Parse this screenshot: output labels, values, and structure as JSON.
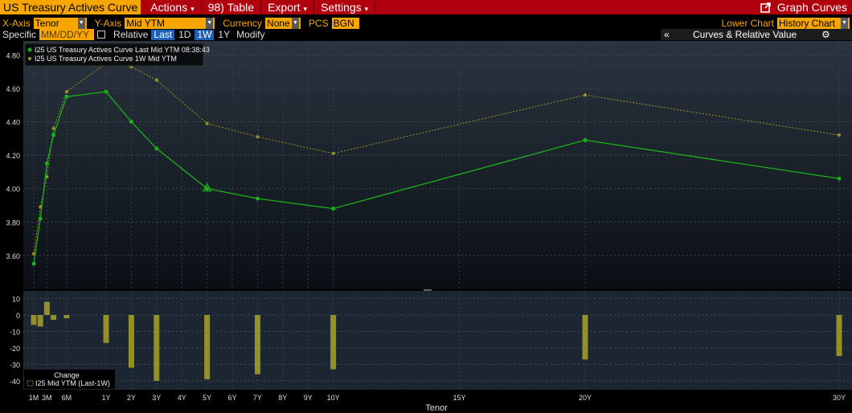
{
  "toolbar": {
    "title": "US Treasury Actives Curve",
    "actions_label": "Actions",
    "table_label": "98) Table",
    "export_label": "Export",
    "settings_label": "Settings",
    "graph_curves_label": "Graph Curves"
  },
  "controls": {
    "xaxis_label": "X-Axis",
    "xaxis_value": "Tenor",
    "yaxis_label": "Y-Axis",
    "yaxis_value": "Mid YTM",
    "currency_label": "Currency",
    "currency_value": "None",
    "pcs_label": "PCS",
    "pcs_value": "BGN",
    "lower_chart_label": "Lower Chart",
    "lower_chart_value": "History Chart",
    "specific_label": "Specific",
    "date_placeholder": "MM/DD/YY",
    "relative_label": "Relative",
    "relative_options": [
      "Last",
      "1D",
      "1W",
      "1Y"
    ],
    "relative_active": [
      "Last",
      "1W"
    ],
    "modify_label": "Modify",
    "panel_collapse": "«",
    "panel_title": "Curves & Relative Value",
    "panel_gear": "⚙"
  },
  "colors": {
    "menubar": "#b0000e",
    "accent": "#f7a600",
    "last_curve": "#19b119",
    "week_curve": "#9f9320",
    "bars": "#a8a326",
    "active_button": "#1f61b5"
  },
  "chart_data": {
    "type": "line",
    "legend": {
      "placement": "top-left",
      "entries": [
        "I25 US Treasury Actives Curve Last Mid YTM 08:38:43",
        "I25 US Treasury Actives Curve 1W Mid YTM"
      ]
    },
    "x_labels": [
      "1M",
      "3M",
      "6M",
      "1Y",
      "2Y",
      "3Y",
      "4Y",
      "5Y",
      "6Y",
      "7Y",
      "8Y",
      "9Y",
      "10Y",
      "15Y",
      "20Y",
      "30Y"
    ],
    "xlabel": "Tenor",
    "top": {
      "ylim": [
        3.45,
        4.85
      ],
      "yticks": [
        "3.60",
        "3.80",
        "4.00",
        "4.20",
        "4.40",
        "4.60",
        "4.80"
      ],
      "series": [
        {
          "name": "I25 US Treasury Actives Curve Last Mid YTM 08:38:43",
          "points": [
            [
              "1M",
              3.55
            ],
            [
              "2M",
              3.82
            ],
            [
              "3M",
              4.15
            ],
            [
              "4M",
              4.32
            ],
            [
              "6M",
              4.55
            ],
            [
              "1Y",
              4.58
            ],
            [
              "2Y",
              4.4
            ],
            [
              "3Y",
              4.24
            ],
            [
              "5Y",
              4.0
            ],
            [
              "7Y",
              3.94
            ],
            [
              "10Y",
              3.88
            ],
            [
              "20Y",
              4.29
            ],
            [
              "30Y",
              4.06
            ]
          ]
        },
        {
          "name": "I25 US Treasury Actives Curve 1W Mid YTM",
          "points": [
            [
              "1M",
              3.61
            ],
            [
              "2M",
              3.89
            ],
            [
              "3M",
              4.07
            ],
            [
              "4M",
              4.36
            ],
            [
              "6M",
              4.58
            ],
            [
              "1Y",
              4.75
            ],
            [
              "2Y",
              4.73
            ],
            [
              "3Y",
              4.65
            ],
            [
              "5Y",
              4.39
            ],
            [
              "7Y",
              4.31
            ],
            [
              "10Y",
              4.21
            ],
            [
              "20Y",
              4.56
            ],
            [
              "30Y",
              4.32
            ]
          ]
        }
      ]
    },
    "bottom": {
      "type": "bar",
      "ylim": [
        -45,
        12
      ],
      "yticks": [
        "10",
        "0",
        "-10",
        "-20",
        "-30",
        "-40"
      ],
      "legend_title": "Change",
      "legend_entry": "I25 Mid YTM (Last-1W)",
      "bars": [
        [
          "1M",
          -6
        ],
        [
          "2M",
          -7
        ],
        [
          "3M",
          8
        ],
        [
          "4M",
          -3
        ],
        [
          "6M",
          -2
        ],
        [
          "1Y",
          -17
        ],
        [
          "2Y",
          -32
        ],
        [
          "3Y",
          -40
        ],
        [
          "5Y",
          -39
        ],
        [
          "7Y",
          -36
        ],
        [
          "10Y",
          -33
        ],
        [
          "20Y",
          -27
        ],
        [
          "30Y",
          -25
        ]
      ]
    }
  }
}
